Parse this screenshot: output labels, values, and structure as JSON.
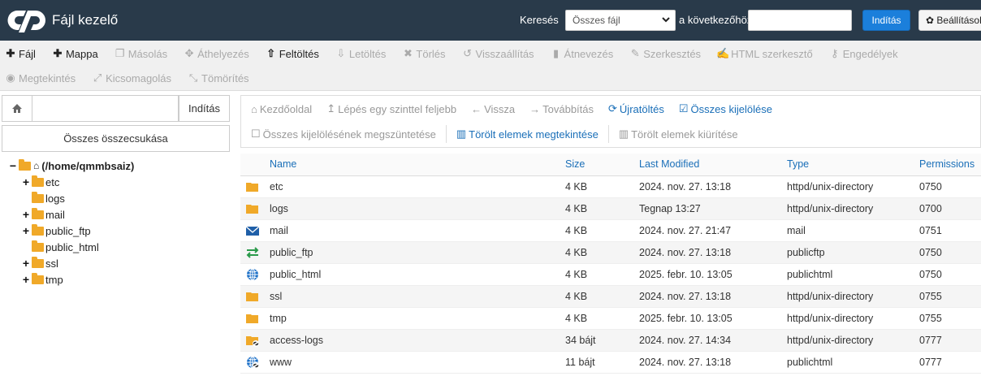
{
  "header": {
    "app_title": "Fájl kezelő",
    "search_label": "Keresés",
    "search_scope": "Összes fájl",
    "to_label": "a következőhöz:",
    "search_value": "",
    "go_label": "Indítás",
    "settings_label": "Beállítások"
  },
  "toolbar": {
    "row1": [
      {
        "label": "Fájl",
        "icon": "plus-icon",
        "active": true
      },
      {
        "label": "Mappa",
        "icon": "plus-icon",
        "active": true
      },
      {
        "label": "Másolás",
        "icon": "copy-icon",
        "active": false
      },
      {
        "label": "Áthelyezés",
        "icon": "move-icon",
        "active": false
      },
      {
        "label": "Feltöltés",
        "icon": "upload-icon",
        "active": true
      },
      {
        "label": "Letöltés",
        "icon": "download-icon",
        "active": false
      },
      {
        "label": "Törlés",
        "icon": "delete-icon",
        "active": false
      },
      {
        "label": "Visszaállítás",
        "icon": "restore-icon",
        "active": false
      },
      {
        "label": "Átnevezés",
        "icon": "rename-icon",
        "active": false
      },
      {
        "label": "Szerkesztés",
        "icon": "pencil-icon",
        "active": false
      },
      {
        "label": "HTML szerkesztő",
        "icon": "html-edit-icon",
        "active": false
      },
      {
        "label": "Engedélyek",
        "icon": "key-icon",
        "active": false
      }
    ],
    "row2": [
      {
        "label": "Megtekintés",
        "icon": "eye-icon",
        "active": false
      },
      {
        "label": "Kicsomagolás",
        "icon": "expand-icon",
        "active": false
      },
      {
        "label": "Tömörítés",
        "icon": "compress-icon",
        "active": false
      }
    ]
  },
  "sidebar": {
    "path_value": "",
    "go_label": "Indítás",
    "collapse_all": "Összes összecsukása",
    "tree": [
      {
        "label": "(/home/qmmbsaiz)",
        "toggle": "−",
        "level": 0,
        "root": true
      },
      {
        "label": "etc",
        "toggle": "+",
        "level": 1
      },
      {
        "label": "logs",
        "toggle": "",
        "level": 1
      },
      {
        "label": "mail",
        "toggle": "+",
        "level": 1
      },
      {
        "label": "public_ftp",
        "toggle": "+",
        "level": 1
      },
      {
        "label": "public_html",
        "toggle": "",
        "level": 1
      },
      {
        "label": "ssl",
        "toggle": "+",
        "level": 1
      },
      {
        "label": "tmp",
        "toggle": "+",
        "level": 1
      }
    ]
  },
  "nav": {
    "row1": [
      {
        "label": "Kezdőoldal",
        "icon": "home-icon",
        "blue": false
      },
      {
        "label": "Lépés egy szinttel feljebb",
        "icon": "level-up-icon",
        "blue": false
      },
      {
        "label": "Vissza",
        "icon": "arrow-left-icon",
        "blue": false
      },
      {
        "label": "Továbbítás",
        "icon": "arrow-right-icon",
        "blue": false
      },
      {
        "label": "Újratöltés",
        "icon": "reload-icon",
        "blue": true
      },
      {
        "label": "Összes kijelölése",
        "icon": "checkbox-checked-icon",
        "blue": true
      }
    ],
    "row2": [
      {
        "label": "Összes kijelölésének megszüntetése",
        "icon": "checkbox-empty-icon",
        "blue": false
      },
      {
        "label": "Törölt elemek megtekintése",
        "icon": "trash-icon",
        "blue": true
      },
      {
        "label": "Törölt elemek kiürítése",
        "icon": "trash-icon",
        "blue": false
      }
    ]
  },
  "table": {
    "headers": {
      "name": "Name",
      "size": "Size",
      "modified": "Last Modified",
      "type": "Type",
      "perm": "Permissions"
    },
    "rows": [
      {
        "icon": "folder-icon",
        "name": "etc",
        "size": "4 KB",
        "modified": "2024. nov. 27. 13:18",
        "type": "httpd/unix-directory",
        "perm": "0750"
      },
      {
        "icon": "folder-icon",
        "name": "logs",
        "size": "4 KB",
        "modified": "Tegnap 13:27",
        "type": "httpd/unix-directory",
        "perm": "0700"
      },
      {
        "icon": "mail-icon",
        "name": "mail",
        "size": "4 KB",
        "modified": "2024. nov. 27. 21:47",
        "type": "mail",
        "perm": "0751"
      },
      {
        "icon": "ftp-icon",
        "name": "public_ftp",
        "size": "4 KB",
        "modified": "2024. nov. 27. 13:18",
        "type": "publicftp",
        "perm": "0750"
      },
      {
        "icon": "globe-icon",
        "name": "public_html",
        "size": "4 KB",
        "modified": "2025. febr. 10. 13:05",
        "type": "publichtml",
        "perm": "0750"
      },
      {
        "icon": "folder-icon",
        "name": "ssl",
        "size": "4 KB",
        "modified": "2024. nov. 27. 13:18",
        "type": "httpd/unix-directory",
        "perm": "0755"
      },
      {
        "icon": "folder-icon",
        "name": "tmp",
        "size": "4 KB",
        "modified": "2025. febr. 10. 13:05",
        "type": "httpd/unix-directory",
        "perm": "0755"
      },
      {
        "icon": "folder-link-icon",
        "name": "access-logs",
        "size": "34 bájt",
        "modified": "2024. nov. 27. 14:34",
        "type": "httpd/unix-directory",
        "perm": "0777"
      },
      {
        "icon": "globe-link-icon",
        "name": "www",
        "size": "11 bájt",
        "modified": "2024. nov. 27. 13:18",
        "type": "publichtml",
        "perm": "0777"
      }
    ]
  }
}
